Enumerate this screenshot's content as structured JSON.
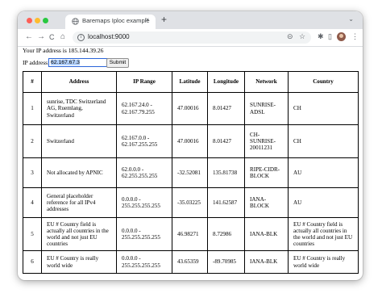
{
  "browser": {
    "tab_title": "Baremaps Iploc example",
    "tab_close": "×",
    "new_tab": "+",
    "tab_menu": "⌄",
    "nav_back": "←",
    "nav_forward": "→",
    "nav_reload": "C",
    "nav_home": "⌂",
    "url": "localhost:9000",
    "site_info": "i",
    "zoom_icon": "⊝",
    "bookmark_icon": "☆",
    "extensions_icon": "✱",
    "sidepanel_icon": "▯",
    "menu_icon": "⋮"
  },
  "page": {
    "ip_text": "Your IP address is 185.144.39.26",
    "ip_label": "IP address:",
    "ip_value": "62.167.67.3",
    "submit_label": "Submit"
  },
  "table": {
    "headers": [
      "#",
      "Address",
      "IP Range",
      "Latitude",
      "Longitude",
      "Network",
      "Country"
    ],
    "rows": [
      [
        "1",
        "sunrise, TDC Switzerland AG, Ruemlang, Switzerland",
        "62.167.24.0 - 62.167.79.255",
        "47.00016",
        "8.01427",
        "SUNRISE-ADSL",
        "CH"
      ],
      [
        "2",
        "Switzerland",
        "62.167.0.0 - 62.167.255.255",
        "47.00016",
        "8.01427",
        "CH-SUNRISE-20011231",
        "CH"
      ],
      [
        "3",
        "Not allocated by APNIC",
        "62.0.0.0 - 62.255.255.255",
        "-32.52081",
        "135.81738",
        "RIPE-CIDR-BLOCK",
        "AU"
      ],
      [
        "4",
        "General placeholder reference for all IPv4 addresses",
        "0.0.0.0 - 255.255.255.255",
        "-35.03225",
        "141.62587",
        "IANA-BLOCK",
        "AU"
      ],
      [
        "5",
        "EU # Country field is actually all countries in the world and not just EU countries",
        "0.0.0.0 - 255.255.255.255",
        "46.98271",
        "8.72986",
        "IANA-BLK",
        "EU # Country field is actually all countries in the world and not just EU countries"
      ],
      [
        "6",
        "EU # Country is really world wide",
        "0.0.0.0 - 255.255.255.255",
        "43.65359",
        "-89.70985",
        "IANA-BLK",
        "EU # Country is really world wide"
      ]
    ]
  }
}
